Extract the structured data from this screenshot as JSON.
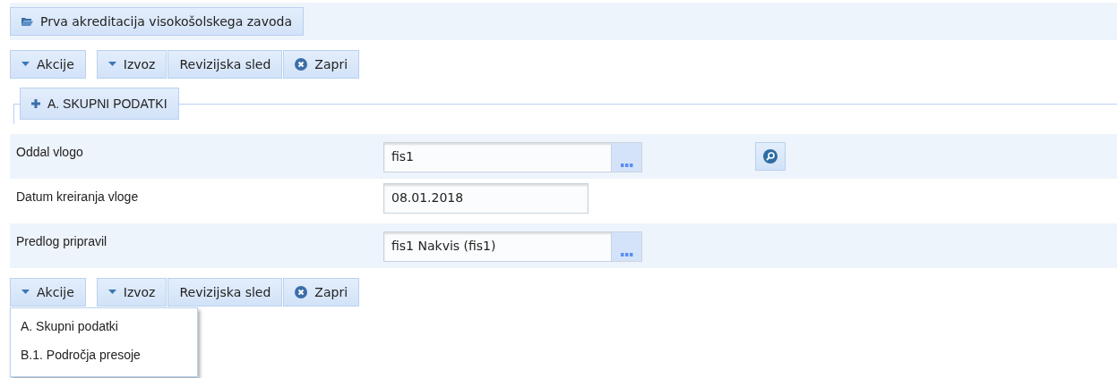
{
  "header": {
    "title": "Prva akreditacija visokošolskega zavoda"
  },
  "toolbar_top": {
    "groups": [
      [
        {
          "kind": "dropdown",
          "label": "Akcije"
        }
      ],
      [
        {
          "kind": "dropdown",
          "label": "Izvoz"
        },
        {
          "kind": "plain",
          "label": "Revizijska sled"
        },
        {
          "kind": "close",
          "label": "Zapri"
        }
      ]
    ]
  },
  "section": {
    "label": "A. SKUPNI PODATKI"
  },
  "fields": [
    {
      "kind": "lookup_search",
      "label": "Oddal vlogo",
      "value": "fis1"
    },
    {
      "kind": "text",
      "label": "Datum kreiranja vloge",
      "value": "08.01.2018"
    },
    {
      "kind": "lookup",
      "label": "Predlog pripravil",
      "value": "fis1 Nakvis (fis1)"
    }
  ],
  "toolbar_bottom": {
    "groups": [
      [
        {
          "kind": "dropdown",
          "label": "Akcije",
          "menu": [
            "A. Skupni podatki",
            "B.1. Področja presoje"
          ]
        }
      ],
      [
        {
          "kind": "dropdown",
          "label": "Izvoz"
        },
        {
          "kind": "plain",
          "label": "Revizijska sled"
        },
        {
          "kind": "close",
          "label": "Zapri"
        }
      ]
    ]
  }
}
